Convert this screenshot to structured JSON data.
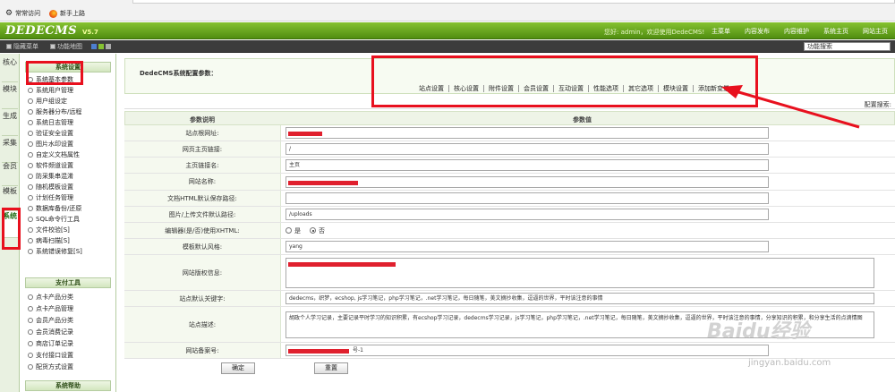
{
  "bookmarks": {
    "frequent": "常常访问",
    "getting_started": "新手上路"
  },
  "header": {
    "logo": "DEDECMS",
    "version": "V5.7",
    "welcome": "您好: admin，欢迎使用DedeCMS!",
    "nav": [
      "主菜单",
      "内容发布",
      "内容维护",
      "系统主页",
      "网站主页"
    ]
  },
  "toolbar": {
    "hide_menu": "隐藏菜单",
    "function_map": "功能地图",
    "search_placeholder": "功能搜索"
  },
  "vertical_tabs": [
    "核心",
    "模块",
    "生成",
    "采集",
    "会员",
    "模板",
    "系统"
  ],
  "sidebar": {
    "system_settings": {
      "title": "系统设置",
      "items": [
        "系统基本参数",
        "系统用户管理",
        "用户组设定",
        "服务器分布/远程",
        "系统日志管理",
        "验证安全设置",
        "图片水印设置",
        "自定义文档属性",
        "软件频道设置",
        "防采集串混淆",
        "随机模板设置",
        "计划任务管理",
        "数据库备份/还原",
        "SQL命令行工具",
        "文件校验[S]",
        "病毒扫描[S]",
        "系统错误修复[S]"
      ]
    },
    "payment": {
      "title": "支付工具",
      "items": [
        "点卡产品分类",
        "点卡产品管理",
        "会员产品分类",
        "会员消费记录",
        "商店订单记录",
        "支付接口设置",
        "配货方式设置"
      ]
    },
    "help": {
      "title": "系统帮助"
    }
  },
  "config": {
    "title": "DedeCMS系统配置参数：",
    "tabs": [
      "站点设置",
      "核心设置",
      "附件设置",
      "会员设置",
      "互动设置",
      "性能选项",
      "其它选项",
      "模块设置",
      "添加新变量"
    ],
    "search_label": "配置搜索:",
    "col_param": "参数说明",
    "col_value": "参数值",
    "fields": {
      "site_url": {
        "label": "站点根网址:",
        "value": ""
      },
      "home_link": {
        "label": "网页主页链接:",
        "value": "/"
      },
      "home_name": {
        "label": "主页链接名:",
        "value": "主页"
      },
      "site_name": {
        "label": "网站名称:",
        "value": ""
      },
      "html_path": {
        "label": "文档HTML默认保存路径:",
        "value": ""
      },
      "upload_path": {
        "label": "图片/上传文件默认路径:",
        "value": "/uploads"
      },
      "editor_xhtml": {
        "label": "编辑器(是/否)使用XHTML:",
        "yes": "是",
        "no": "否"
      },
      "template_style": {
        "label": "模板默认风格:",
        "value": "yang"
      },
      "copyright": {
        "label": "网站版权信息:",
        "value": ""
      },
      "keywords": {
        "label": "站点默认关键字:",
        "value": "dedecms，织梦，ecshop, js学习笔记，php学习笔记，.net学习笔记，每日随笔，美文摘抄收集，逗逼的世界，平时该注意的事情"
      },
      "description": {
        "label": "站点描述:",
        "value": "胡政个人学习记录，主要记录平时学习的知识积累，有ecshop学习记录，dedecms学习记录，js学习笔记，php学习笔记，.net学习笔记，每日随笔，美文摘抄收集，逗逼的世界，平时该注意的事情，分享知识的积累，和分享生活的点滴情图"
      },
      "icp": {
        "label": "网站备案号:",
        "value": "号-1"
      }
    },
    "confirm": "确定",
    "reset": "重置"
  },
  "watermark": {
    "brand": "Baidu经验",
    "url": "jingyan.baidu.com"
  }
}
